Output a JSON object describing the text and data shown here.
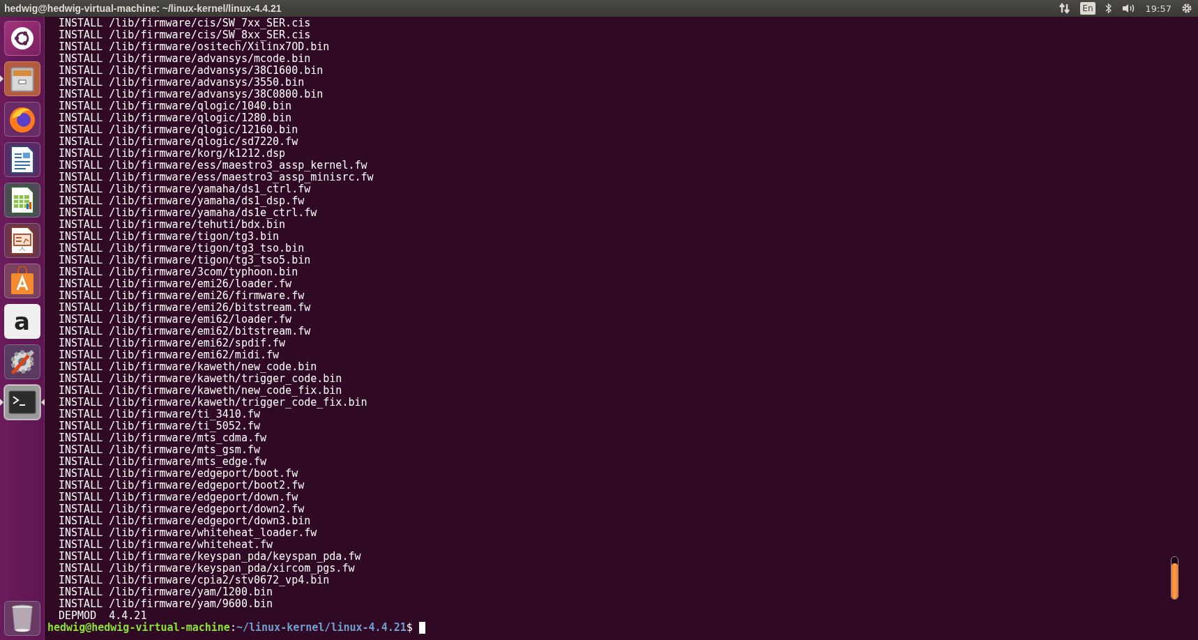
{
  "top_bar": {
    "title": "hedwig@hedwig-virtual-machine: ~/linux-kernel/linux-4.4.21",
    "keyboard_layout": "En",
    "clock": "19:57"
  },
  "launcher": {
    "items": [
      {
        "kind": "dash",
        "running": false,
        "focused": false
      },
      {
        "kind": "files",
        "running": true,
        "focused": false
      },
      {
        "kind": "firefox",
        "running": false,
        "focused": false
      },
      {
        "kind": "writer",
        "running": false,
        "focused": false
      },
      {
        "kind": "calc",
        "running": false,
        "focused": false
      },
      {
        "kind": "impress",
        "running": false,
        "focused": false
      },
      {
        "kind": "software",
        "running": false,
        "focused": false
      },
      {
        "kind": "amazon",
        "glyph": "a",
        "running": false,
        "focused": false
      },
      {
        "kind": "settings",
        "running": false,
        "focused": false
      },
      {
        "kind": "terminal",
        "running": true,
        "focused": true
      }
    ],
    "trash": {
      "kind": "trash"
    }
  },
  "terminal": {
    "lines": [
      "INSTALL /lib/firmware/cis/SW_7xx_SER.cis",
      "INSTALL /lib/firmware/cis/SW_8xx_SER.cis",
      "INSTALL /lib/firmware/ositech/Xilinx7OD.bin",
      "INSTALL /lib/firmware/advansys/mcode.bin",
      "INSTALL /lib/firmware/advansys/38C1600.bin",
      "INSTALL /lib/firmware/advansys/3550.bin",
      "INSTALL /lib/firmware/advansys/38C0800.bin",
      "INSTALL /lib/firmware/qlogic/1040.bin",
      "INSTALL /lib/firmware/qlogic/1280.bin",
      "INSTALL /lib/firmware/qlogic/12160.bin",
      "INSTALL /lib/firmware/qlogic/sd7220.fw",
      "INSTALL /lib/firmware/korg/k1212.dsp",
      "INSTALL /lib/firmware/ess/maestro3_assp_kernel.fw",
      "INSTALL /lib/firmware/ess/maestro3_assp_minisrc.fw",
      "INSTALL /lib/firmware/yamaha/ds1_ctrl.fw",
      "INSTALL /lib/firmware/yamaha/ds1_dsp.fw",
      "INSTALL /lib/firmware/yamaha/ds1e_ctrl.fw",
      "INSTALL /lib/firmware/tehuti/bdx.bin",
      "INSTALL /lib/firmware/tigon/tg3.bin",
      "INSTALL /lib/firmware/tigon/tg3_tso.bin",
      "INSTALL /lib/firmware/tigon/tg3_tso5.bin",
      "INSTALL /lib/firmware/3com/typhoon.bin",
      "INSTALL /lib/firmware/emi26/loader.fw",
      "INSTALL /lib/firmware/emi26/firmware.fw",
      "INSTALL /lib/firmware/emi26/bitstream.fw",
      "INSTALL /lib/firmware/emi62/loader.fw",
      "INSTALL /lib/firmware/emi62/bitstream.fw",
      "INSTALL /lib/firmware/emi62/spdif.fw",
      "INSTALL /lib/firmware/emi62/midi.fw",
      "INSTALL /lib/firmware/kaweth/new_code.bin",
      "INSTALL /lib/firmware/kaweth/trigger_code.bin",
      "INSTALL /lib/firmware/kaweth/new_code_fix.bin",
      "INSTALL /lib/firmware/kaweth/trigger_code_fix.bin",
      "INSTALL /lib/firmware/ti_3410.fw",
      "INSTALL /lib/firmware/ti_5052.fw",
      "INSTALL /lib/firmware/mts_cdma.fw",
      "INSTALL /lib/firmware/mts_gsm.fw",
      "INSTALL /lib/firmware/mts_edge.fw",
      "INSTALL /lib/firmware/edgeport/boot.fw",
      "INSTALL /lib/firmware/edgeport/boot2.fw",
      "INSTALL /lib/firmware/edgeport/down.fw",
      "INSTALL /lib/firmware/edgeport/down2.fw",
      "INSTALL /lib/firmware/edgeport/down3.bin",
      "INSTALL /lib/firmware/whiteheat_loader.fw",
      "INSTALL /lib/firmware/whiteheat.fw",
      "INSTALL /lib/firmware/keyspan_pda/keyspan_pda.fw",
      "INSTALL /lib/firmware/keyspan_pda/xircom_pgs.fw",
      "INSTALL /lib/firmware/cpia2/stv0672_vp4.bin",
      "INSTALL /lib/firmware/yam/1200.bin",
      "INSTALL /lib/firmware/yam/9600.bin",
      "DEPMOD  4.4.21"
    ],
    "prompt": {
      "user_host": "hedwig@hedwig-virtual-machine",
      "separator": ":",
      "path": "~/linux-kernel/linux-4.4.21",
      "symbol": "$"
    }
  }
}
